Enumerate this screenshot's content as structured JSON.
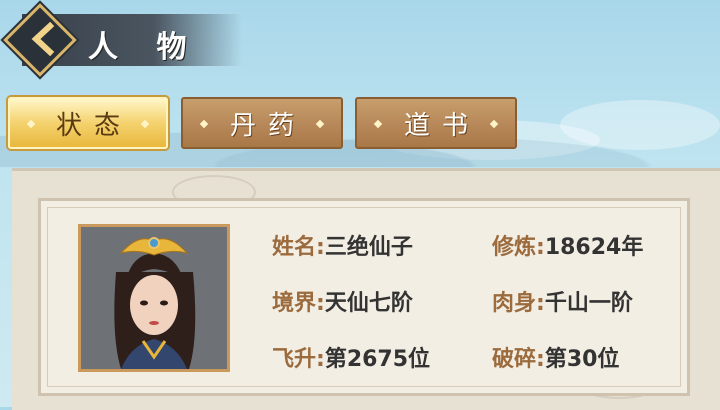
{
  "header": {
    "title": "人 物",
    "back_icon": "chevron-left-icon"
  },
  "tabs": [
    {
      "label": "状态",
      "active": true
    },
    {
      "label": "丹药",
      "active": false
    },
    {
      "label": "道书",
      "active": false
    }
  ],
  "character": {
    "portrait": "female-immortal-avatar",
    "stats": [
      {
        "label": "姓名:",
        "value": "三绝仙子"
      },
      {
        "label": "修炼:",
        "value": "18624年"
      },
      {
        "label": "境界:",
        "value": "天仙七阶"
      },
      {
        "label": "肉身:",
        "value": "千山一阶"
      },
      {
        "label": "飞升:",
        "value": "第2675位"
      },
      {
        "label": "破碎:",
        "value": "第30位"
      }
    ]
  },
  "colors": {
    "label": "#9b6b3e",
    "value": "#333333",
    "tab_active": "#f4d26e",
    "tab_inactive": "#b8895a"
  }
}
